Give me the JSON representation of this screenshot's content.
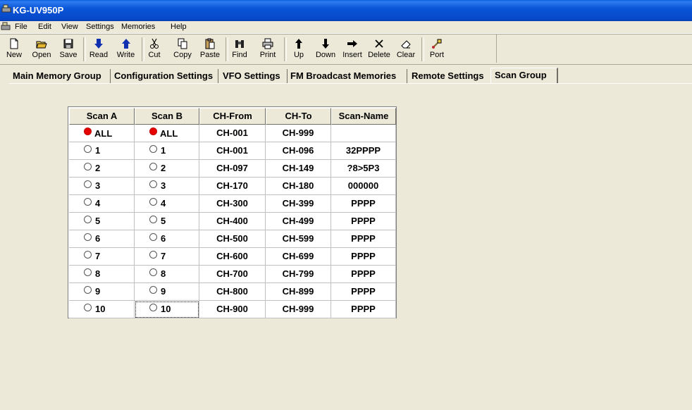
{
  "window": {
    "title": "KG-UV950P"
  },
  "menu": [
    "File",
    "Edit",
    "View",
    "Settings",
    "Memories",
    "Help"
  ],
  "toolbar": [
    {
      "label": "New",
      "icon": "new-file-icon"
    },
    {
      "label": "Open",
      "icon": "open-folder-icon"
    },
    {
      "label": "Save",
      "icon": "save-disk-icon"
    },
    {
      "label": "Read",
      "icon": "arrow-down-icon"
    },
    {
      "label": "Write",
      "icon": "arrow-up-icon"
    },
    {
      "label": "Cut",
      "icon": "scissors-icon"
    },
    {
      "label": "Copy",
      "icon": "copy-icon"
    },
    {
      "label": "Paste",
      "icon": "paste-icon"
    },
    {
      "label": "Find",
      "icon": "binoculars-icon"
    },
    {
      "label": "Print",
      "icon": "printer-icon"
    },
    {
      "label": "Up",
      "icon": "arrow-up-icon"
    },
    {
      "label": "Down",
      "icon": "arrow-down-icon"
    },
    {
      "label": "Insert",
      "icon": "arrow-right-icon"
    },
    {
      "label": "Delete",
      "icon": "x-icon"
    },
    {
      "label": "Clear",
      "icon": "eraser-icon"
    },
    {
      "label": "Port",
      "icon": "port-plug-icon"
    }
  ],
  "tabs": [
    {
      "label": "Main Memory Group",
      "active": false
    },
    {
      "label": "Configuration Settings",
      "active": false
    },
    {
      "label": "VFO Settings",
      "active": false
    },
    {
      "label": "FM Broadcast Memories",
      "active": false
    },
    {
      "label": "Remote Settings",
      "active": false
    },
    {
      "label": "Scan Group",
      "active": true
    }
  ],
  "grid": {
    "columns": [
      "Scan A",
      "Scan B",
      "CH-From",
      "CH-To",
      "Scan-Name"
    ],
    "rows": [
      {
        "scan_a": "ALL",
        "scan_a_selected": true,
        "scan_b": "ALL",
        "scan_b_selected": true,
        "ch_from": "CH-001",
        "ch_to": "CH-999",
        "name": ""
      },
      {
        "scan_a": "1",
        "scan_a_selected": false,
        "scan_b": "1",
        "scan_b_selected": false,
        "ch_from": "CH-001",
        "ch_to": "CH-096",
        "name": "32PPPP"
      },
      {
        "scan_a": "2",
        "scan_a_selected": false,
        "scan_b": "2",
        "scan_b_selected": false,
        "ch_from": "CH-097",
        "ch_to": "CH-149",
        "name": "?8>5P3"
      },
      {
        "scan_a": "3",
        "scan_a_selected": false,
        "scan_b": "3",
        "scan_b_selected": false,
        "ch_from": "CH-170",
        "ch_to": "CH-180",
        "name": "000000"
      },
      {
        "scan_a": "4",
        "scan_a_selected": false,
        "scan_b": "4",
        "scan_b_selected": false,
        "ch_from": "CH-300",
        "ch_to": "CH-399",
        "name": "PPPP"
      },
      {
        "scan_a": "5",
        "scan_a_selected": false,
        "scan_b": "5",
        "scan_b_selected": false,
        "ch_from": "CH-400",
        "ch_to": "CH-499",
        "name": "PPPP"
      },
      {
        "scan_a": "6",
        "scan_a_selected": false,
        "scan_b": "6",
        "scan_b_selected": false,
        "ch_from": "CH-500",
        "ch_to": "CH-599",
        "name": "PPPP"
      },
      {
        "scan_a": "7",
        "scan_a_selected": false,
        "scan_b": "7",
        "scan_b_selected": false,
        "ch_from": "CH-600",
        "ch_to": "CH-699",
        "name": "PPPP"
      },
      {
        "scan_a": "8",
        "scan_a_selected": false,
        "scan_b": "8",
        "scan_b_selected": false,
        "ch_from": "CH-700",
        "ch_to": "CH-799",
        "name": "PPPP"
      },
      {
        "scan_a": "9",
        "scan_a_selected": false,
        "scan_b": "9",
        "scan_b_selected": false,
        "ch_from": "CH-800",
        "ch_to": "CH-899",
        "name": "PPPP"
      },
      {
        "scan_a": "10",
        "scan_a_selected": false,
        "scan_b": "10",
        "scan_b_selected": false,
        "ch_from": "CH-900",
        "ch_to": "CH-999",
        "name": "PPPP"
      }
    ]
  },
  "colors": {
    "titlebar": "#0A5FE0",
    "radio_selected": "#E60000",
    "panel": "#ECE9D8"
  }
}
